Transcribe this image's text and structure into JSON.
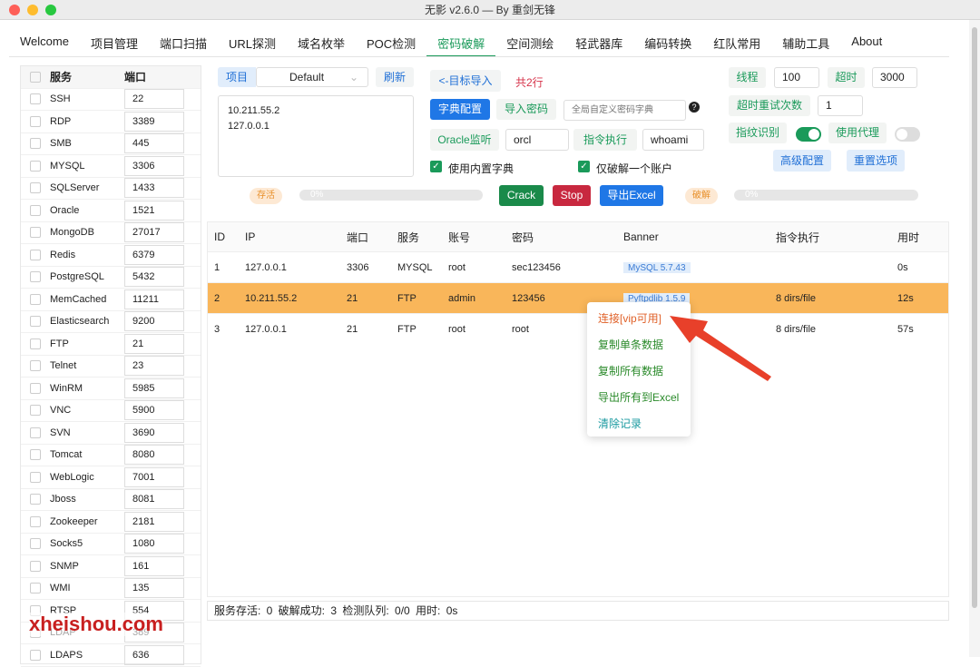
{
  "window": {
    "title": "无影 v2.6.0 — By 重剑无锋"
  },
  "tabs": [
    "Welcome",
    "项目管理",
    "端口扫描",
    "URL探测",
    "域名枚举",
    "POC检测",
    "密码破解",
    "空间测绘",
    "轻武器库",
    "编码转换",
    "红队常用",
    "辅助工具",
    "About"
  ],
  "active_tab": "密码破解",
  "services": {
    "header_service": "服务",
    "header_port": "端口",
    "items": [
      {
        "name": "SSH",
        "port": "22"
      },
      {
        "name": "RDP",
        "port": "3389"
      },
      {
        "name": "SMB",
        "port": "445"
      },
      {
        "name": "MYSQL",
        "port": "3306"
      },
      {
        "name": "SQLServer",
        "port": "1433"
      },
      {
        "name": "Oracle",
        "port": "1521"
      },
      {
        "name": "MongoDB",
        "port": "27017"
      },
      {
        "name": "Redis",
        "port": "6379"
      },
      {
        "name": "PostgreSQL",
        "port": "5432"
      },
      {
        "name": "MemCached",
        "port": "11211"
      },
      {
        "name": "Elasticsearch",
        "port": "9200"
      },
      {
        "name": "FTP",
        "port": "21"
      },
      {
        "name": "Telnet",
        "port": "23"
      },
      {
        "name": "WinRM",
        "port": "5985"
      },
      {
        "name": "VNC",
        "port": "5900"
      },
      {
        "name": "SVN",
        "port": "3690"
      },
      {
        "name": "Tomcat",
        "port": "8080"
      },
      {
        "name": "WebLogic",
        "port": "7001"
      },
      {
        "name": "Jboss",
        "port": "8081"
      },
      {
        "name": "Zookeeper",
        "port": "2181"
      },
      {
        "name": "Socks5",
        "port": "1080"
      },
      {
        "name": "SNMP",
        "port": "161"
      },
      {
        "name": "WMI",
        "port": "135"
      },
      {
        "name": "RTSP",
        "port": "554"
      },
      {
        "name": "LDAP",
        "port": "389"
      },
      {
        "name": "LDAPS",
        "port": "636"
      }
    ]
  },
  "project": {
    "label": "项目",
    "value": "Default",
    "refresh": "刷新"
  },
  "targets": "10.211.55.2\n127.0.0.1",
  "import_target": "<-目标导入",
  "total": "共2行",
  "dict_config": "字典配置",
  "import_pwd": "导入密码",
  "dict_placeholder": "全局自定义密码字典",
  "oracle_label": "Oracle监听",
  "oracle_value": "orcl",
  "cmd_label": "指令执行",
  "cmd_value": "whoami",
  "use_builtin": "使用内置字典",
  "only_one": "仅破解一个账户",
  "alive_label": "存活",
  "alive_progress": "0%",
  "crack_label": "破解",
  "crack_progress": "0%",
  "crack_btn": "Crack",
  "stop_btn": "Stop",
  "export_btn": "导出Excel",
  "threads_label": "线程",
  "threads": "100",
  "timeout_label": "超时",
  "timeout": "3000",
  "retry_label": "超时重试次数",
  "retry": "1",
  "fingerprint_label": "指纹识别",
  "fingerprint_on": true,
  "proxy_label": "使用代理",
  "proxy_on": false,
  "advanced": "高级配置",
  "reset": "重置选项",
  "table": {
    "headers": [
      "ID",
      "IP",
      "端口",
      "服务",
      "账号",
      "密码",
      "Banner",
      "指令执行",
      "用时"
    ],
    "rows": [
      [
        "1",
        "127.0.0.1",
        "3306",
        "MYSQL",
        "root",
        "sec123456",
        "MySQL 5.7.43",
        "",
        "0s"
      ],
      [
        "2",
        "10.211.55.2",
        "21",
        "FTP",
        "admin",
        "123456",
        "Pyftpdlib 1.5.9",
        "8 dirs/file",
        "12s"
      ],
      [
        "3",
        "127.0.0.1",
        "21",
        "FTP",
        "root",
        "root",
        "",
        "8 dirs/file",
        "57s"
      ]
    ]
  },
  "context_menu": [
    "连接[vip可用]",
    "复制单条数据",
    "复制所有数据",
    "导出所有到Excel",
    "清除记录"
  ],
  "status": "服务存活: 0   破解成功: 3   检测队列: 0/0   用时: 0s",
  "watermark": "xheishou.com",
  "colors": {
    "accent": "#1a9a5a",
    "selected_row": "#f9b65a",
    "stop": "#c8283f",
    "primary": "#1f77e6",
    "arrow": "#e8402a"
  }
}
